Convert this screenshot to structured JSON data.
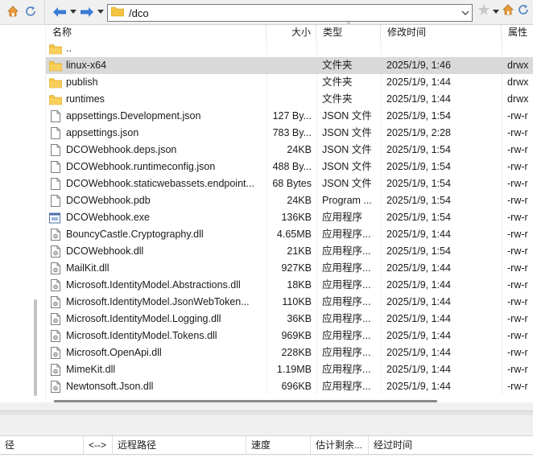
{
  "main": {
    "path": "/dco",
    "columns": {
      "name": "名称",
      "size": "大小",
      "type": "类型",
      "modified": "修改时间",
      "attributes": "属性"
    },
    "files": [
      {
        "name": "..",
        "size": "",
        "type": "",
        "modified": "",
        "attr": "",
        "icon": "folder-icon"
      },
      {
        "name": "linux-x64",
        "size": "",
        "type": "文件夹",
        "modified": "2025/1/9, 1:46",
        "attr": "drwx",
        "icon": "folder-icon"
      },
      {
        "name": "publish",
        "size": "",
        "type": "文件夹",
        "modified": "2025/1/9, 1:44",
        "attr": "drwx",
        "icon": "folder-icon"
      },
      {
        "name": "runtimes",
        "size": "",
        "type": "文件夹",
        "modified": "2025/1/9, 1:44",
        "attr": "drwx",
        "icon": "folder-icon"
      },
      {
        "name": "appsettings.Development.json",
        "size": "127 By...",
        "type": "JSON 文件",
        "modified": "2025/1/9, 1:54",
        "attr": "-rw-r",
        "icon": "file-icon"
      },
      {
        "name": "appsettings.json",
        "size": "783 By...",
        "type": "JSON 文件",
        "modified": "2025/1/9, 2:28",
        "attr": "-rw-r",
        "icon": "file-icon"
      },
      {
        "name": "DCOWebhook.deps.json",
        "size": "24KB",
        "type": "JSON 文件",
        "modified": "2025/1/9, 1:54",
        "attr": "-rw-r",
        "icon": "file-icon"
      },
      {
        "name": "DCOWebhook.runtimeconfig.json",
        "size": "488 By...",
        "type": "JSON 文件",
        "modified": "2025/1/9, 1:54",
        "attr": "-rw-r",
        "icon": "file-icon"
      },
      {
        "name": "DCOWebhook.staticwebassets.endpoint...",
        "size": "68 Bytes",
        "type": "JSON 文件",
        "modified": "2025/1/9, 1:54",
        "attr": "-rw-r",
        "icon": "file-icon"
      },
      {
        "name": "DCOWebhook.pdb",
        "size": "24KB",
        "type": "Program ...",
        "modified": "2025/1/9, 1:54",
        "attr": "-rw-r",
        "icon": "file-icon"
      },
      {
        "name": "DCOWebhook.exe",
        "size": "136KB",
        "type": "应用程序",
        "modified": "2025/1/9, 1:54",
        "attr": "-rw-r",
        "icon": "exe-icon"
      },
      {
        "name": "BouncyCastle.Cryptography.dll",
        "size": "4.65MB",
        "type": "应用程序...",
        "modified": "2025/1/9, 1:44",
        "attr": "-rw-r",
        "icon": "dll-icon"
      },
      {
        "name": "DCOWebhook.dll",
        "size": "21KB",
        "type": "应用程序...",
        "modified": "2025/1/9, 1:54",
        "attr": "-rw-r",
        "icon": "dll-icon"
      },
      {
        "name": "MailKit.dll",
        "size": "927KB",
        "type": "应用程序...",
        "modified": "2025/1/9, 1:44",
        "attr": "-rw-r",
        "icon": "dll-icon"
      },
      {
        "name": "Microsoft.IdentityModel.Abstractions.dll",
        "size": "18KB",
        "type": "应用程序...",
        "modified": "2025/1/9, 1:44",
        "attr": "-rw-r",
        "icon": "dll-icon"
      },
      {
        "name": "Microsoft.IdentityModel.JsonWebToken...",
        "size": "110KB",
        "type": "应用程序...",
        "modified": "2025/1/9, 1:44",
        "attr": "-rw-r",
        "icon": "dll-icon"
      },
      {
        "name": "Microsoft.IdentityModel.Logging.dll",
        "size": "36KB",
        "type": "应用程序...",
        "modified": "2025/1/9, 1:44",
        "attr": "-rw-r",
        "icon": "dll-icon"
      },
      {
        "name": "Microsoft.IdentityModel.Tokens.dll",
        "size": "969KB",
        "type": "应用程序...",
        "modified": "2025/1/9, 1:44",
        "attr": "-rw-r",
        "icon": "dll-icon"
      },
      {
        "name": "Microsoft.OpenApi.dll",
        "size": "228KB",
        "type": "应用程序...",
        "modified": "2025/1/9, 1:44",
        "attr": "-rw-r",
        "icon": "dll-icon"
      },
      {
        "name": "MimeKit.dll",
        "size": "1.19MB",
        "type": "应用程序...",
        "modified": "2025/1/9, 1:44",
        "attr": "-rw-r",
        "icon": "dll-icon"
      },
      {
        "name": "Newtonsoft.Json.dll",
        "size": "696KB",
        "type": "应用程序...",
        "modified": "2025/1/9, 1:44",
        "attr": "-rw-r",
        "icon": "dll-icon"
      }
    ],
    "selected_index": 1
  },
  "queue": {
    "columns": {
      "local_path": "径",
      "direction": "<-->",
      "remote_path": "远程路径",
      "speed": "速度",
      "eta": "估计剩余...",
      "elapsed": "经过时间"
    }
  },
  "colors": {
    "folder": "#f5c342",
    "accent_blue": "#3a7bd5",
    "selected_row": "#d9d9d9"
  }
}
